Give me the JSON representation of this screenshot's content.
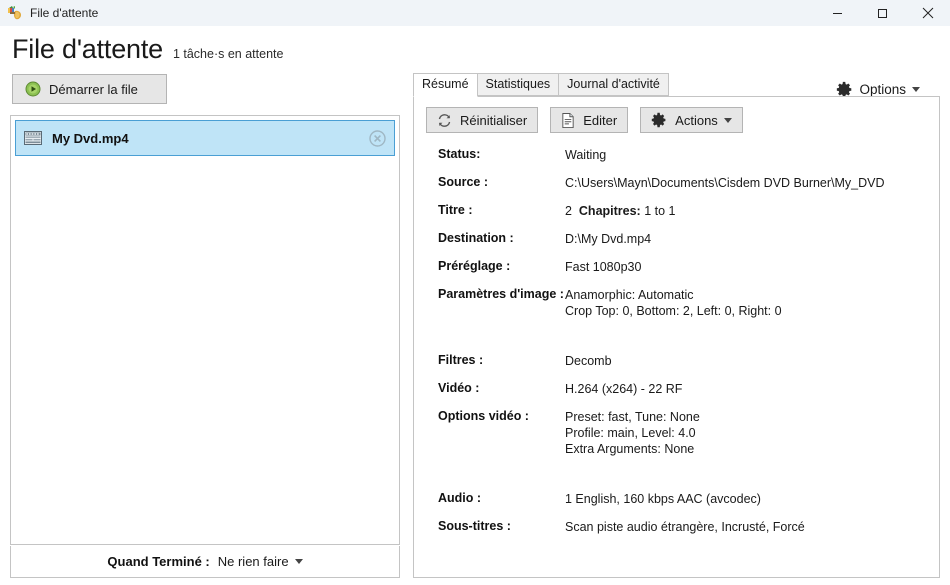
{
  "window": {
    "title": "File d'attente",
    "app_icon": "handbrake-pineapple-icon",
    "controls": {
      "minimize": "minimize-icon",
      "maximize": "maximize-icon",
      "close": "close-icon"
    }
  },
  "header": {
    "title": "File d'attente",
    "subtitle": "1 tâche·s en attente"
  },
  "toolbar": {
    "start_label": "Démarrer la file",
    "start_icon": "play-circle-icon",
    "options_label": "Options",
    "options_icon": "gear-icon"
  },
  "queue": {
    "items": [
      {
        "label": "My Dvd.mp4",
        "icon": "film-strip-icon",
        "remove_icon": "remove-circle-icon",
        "selected": true
      }
    ]
  },
  "footer": {
    "label": "Quand Terminé :",
    "value": "Ne rien faire"
  },
  "right_panel": {
    "tabs": [
      {
        "label": "Résumé",
        "active": true
      },
      {
        "label": "Statistiques",
        "active": false
      },
      {
        "label": "Journal d'activité",
        "active": false
      }
    ],
    "actions": [
      {
        "label": "Réinitialiser",
        "icon": "refresh-icon"
      },
      {
        "label": "Editer",
        "icon": "document-edit-icon"
      },
      {
        "label": "Actions",
        "icon": "gear-icon",
        "has_caret": true
      }
    ],
    "details": [
      {
        "label": "Status:",
        "value": "Waiting"
      },
      {
        "label": "Source :",
        "value": "C:\\Users\\Mayn\\Documents\\Cisdem DVD Burner\\My_DVD"
      },
      {
        "label": "Titre :",
        "title_number": "2",
        "chapters_label": "Chapitres:",
        "chapters_range": "1 to 1"
      },
      {
        "label": "Destination :",
        "value": "D:\\My Dvd.mp4"
      },
      {
        "label": "Préréglage :",
        "value": "Fast 1080p30"
      },
      {
        "label": "Paramètres d'image :",
        "lines": [
          "Anamorphic: Automatic",
          "Crop Top: 0, Bottom: 2, Left: 0, Right: 0"
        ]
      },
      {
        "label": "Filtres :",
        "value": "Decomb"
      },
      {
        "label": "Vidéo :",
        "value": "H.264 (x264) - 22 RF"
      },
      {
        "label": "Options vidéo :",
        "lines": [
          "Preset: fast, Tune: None",
          "Profile: main, Level: 4.0",
          "Extra Arguments: None"
        ]
      },
      {
        "label": "Audio :",
        "value": "1 English, 160 kbps AAC (avcodec)"
      },
      {
        "label": "Sous-titres :",
        "value": "Scan piste audio étrangère, Incrusté, Forcé"
      }
    ]
  },
  "colors": {
    "titlebar_bg": "#f0f4f8",
    "selection_bg": "#bfe4f7",
    "selection_border": "#4a9fd4",
    "button_bg": "#e6e6e6",
    "panel_border": "#c4c4c4",
    "play_green": "#7ab648"
  }
}
